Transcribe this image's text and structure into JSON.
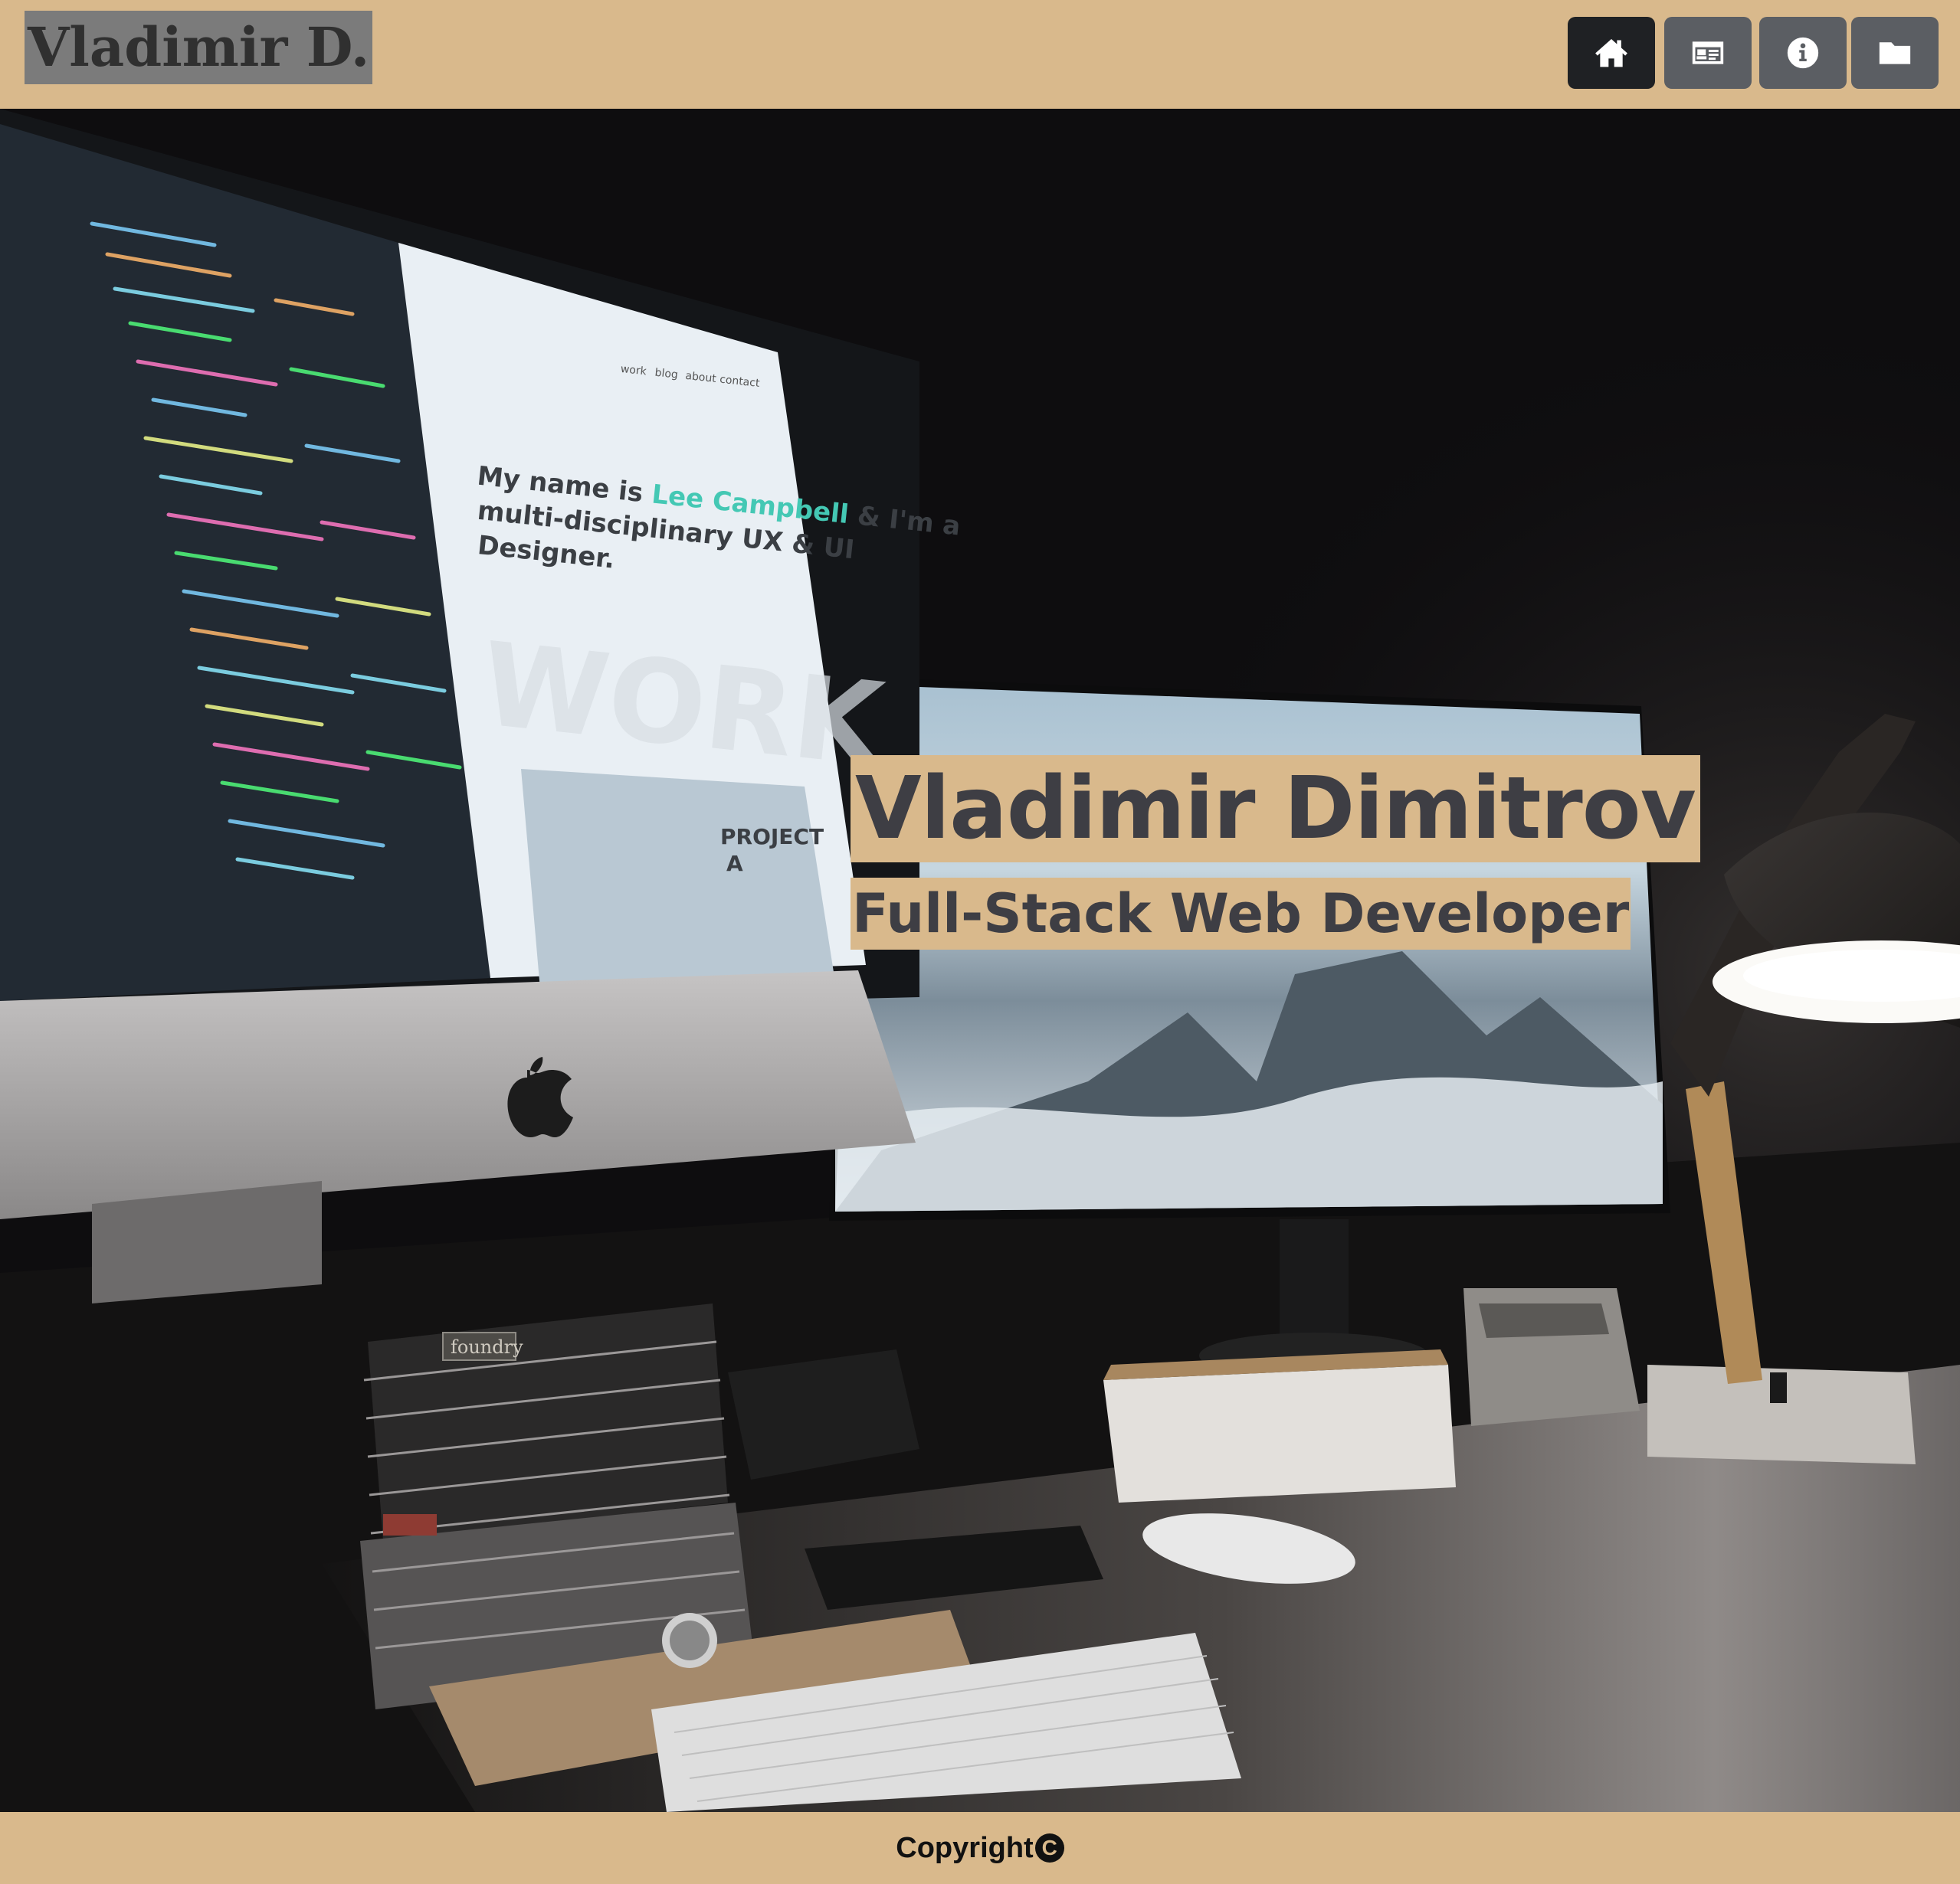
{
  "header": {
    "brand": "Vladimir D.",
    "nav": [
      {
        "icon": "home-icon",
        "active": true
      },
      {
        "icon": "contact-card-icon",
        "active": false
      },
      {
        "icon": "info-icon",
        "active": false
      },
      {
        "icon": "folder-icon",
        "active": false
      }
    ]
  },
  "hero": {
    "title": "Vladimir Dimitrov",
    "subtitle": "Full-Stack Web Developer",
    "photo": {
      "screen_headline_1": "My name is",
      "screen_headline_name": "Lee Campbell",
      "screen_headline_2": "& I'm a",
      "screen_headline_3": "multi-disciplinary UX & UI",
      "screen_headline_4": "Designer.",
      "screen_watermark": "WORK",
      "screen_card_1": "PROJECT",
      "screen_card_2": "A",
      "screen_nav": [
        "work",
        "blog",
        "about",
        "contact"
      ],
      "book_spine": "foundry"
    }
  },
  "footer": {
    "copyright": "Copyright",
    "copyright_symbol": "C"
  },
  "colors": {
    "accent": "#d9b98c",
    "brand_bg": "#7b7b7b",
    "nav_button": "#5b5e63",
    "nav_button_active": "#1f2124",
    "title_text": "#3e3e44"
  }
}
